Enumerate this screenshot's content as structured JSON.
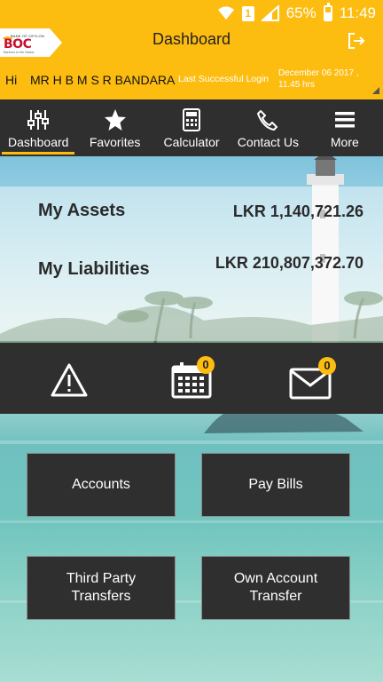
{
  "status_bar": {
    "battery": "65%",
    "time": "11:49",
    "sim_label": "1"
  },
  "header": {
    "title": "Dashboard",
    "logo": {
      "top_text": "BANK OF CEYLON",
      "main_text": "BOC",
      "tagline": "Bankers to the Nation"
    },
    "greeting": "Hi",
    "user_name": "MR H B M S R BANDARA",
    "last_login_label": "Last Successful Login",
    "last_login_value": "December 06 2017 , 11.45 hrs",
    "logout_icon": "logout-icon"
  },
  "nav": {
    "items": [
      {
        "label": "Dashboard",
        "icon": "sliders-icon",
        "active": true
      },
      {
        "label": "Favorites",
        "icon": "star-icon",
        "active": false
      },
      {
        "label": "Calculator",
        "icon": "calculator-icon",
        "active": false
      },
      {
        "label": "Contact Us",
        "icon": "phone-icon",
        "active": false
      },
      {
        "label": "More",
        "icon": "menu-icon",
        "active": false
      }
    ]
  },
  "summary": {
    "assets_label": "My Assets",
    "assets_value": "LKR 1,140,721.26",
    "liabilities_label": "My Liabilities",
    "liabilities_value": "LKR 210,807,372.70"
  },
  "quick_icons": {
    "alert_icon": "warning-icon",
    "calendar_icon": "calendar-icon",
    "calendar_badge": "0",
    "mail_icon": "mail-icon",
    "mail_badge": "0"
  },
  "actions": {
    "accounts": "Accounts",
    "pay_bills": "Pay Bills",
    "third_party_line1": "Third Party",
    "third_party_line2": "Transfers",
    "own_account_line1": "Own Account",
    "own_account_line2": "Transfer"
  },
  "colors": {
    "accent": "#fdbc10",
    "dark": "#2f2f2f",
    "brand_red": "#c8102e"
  }
}
